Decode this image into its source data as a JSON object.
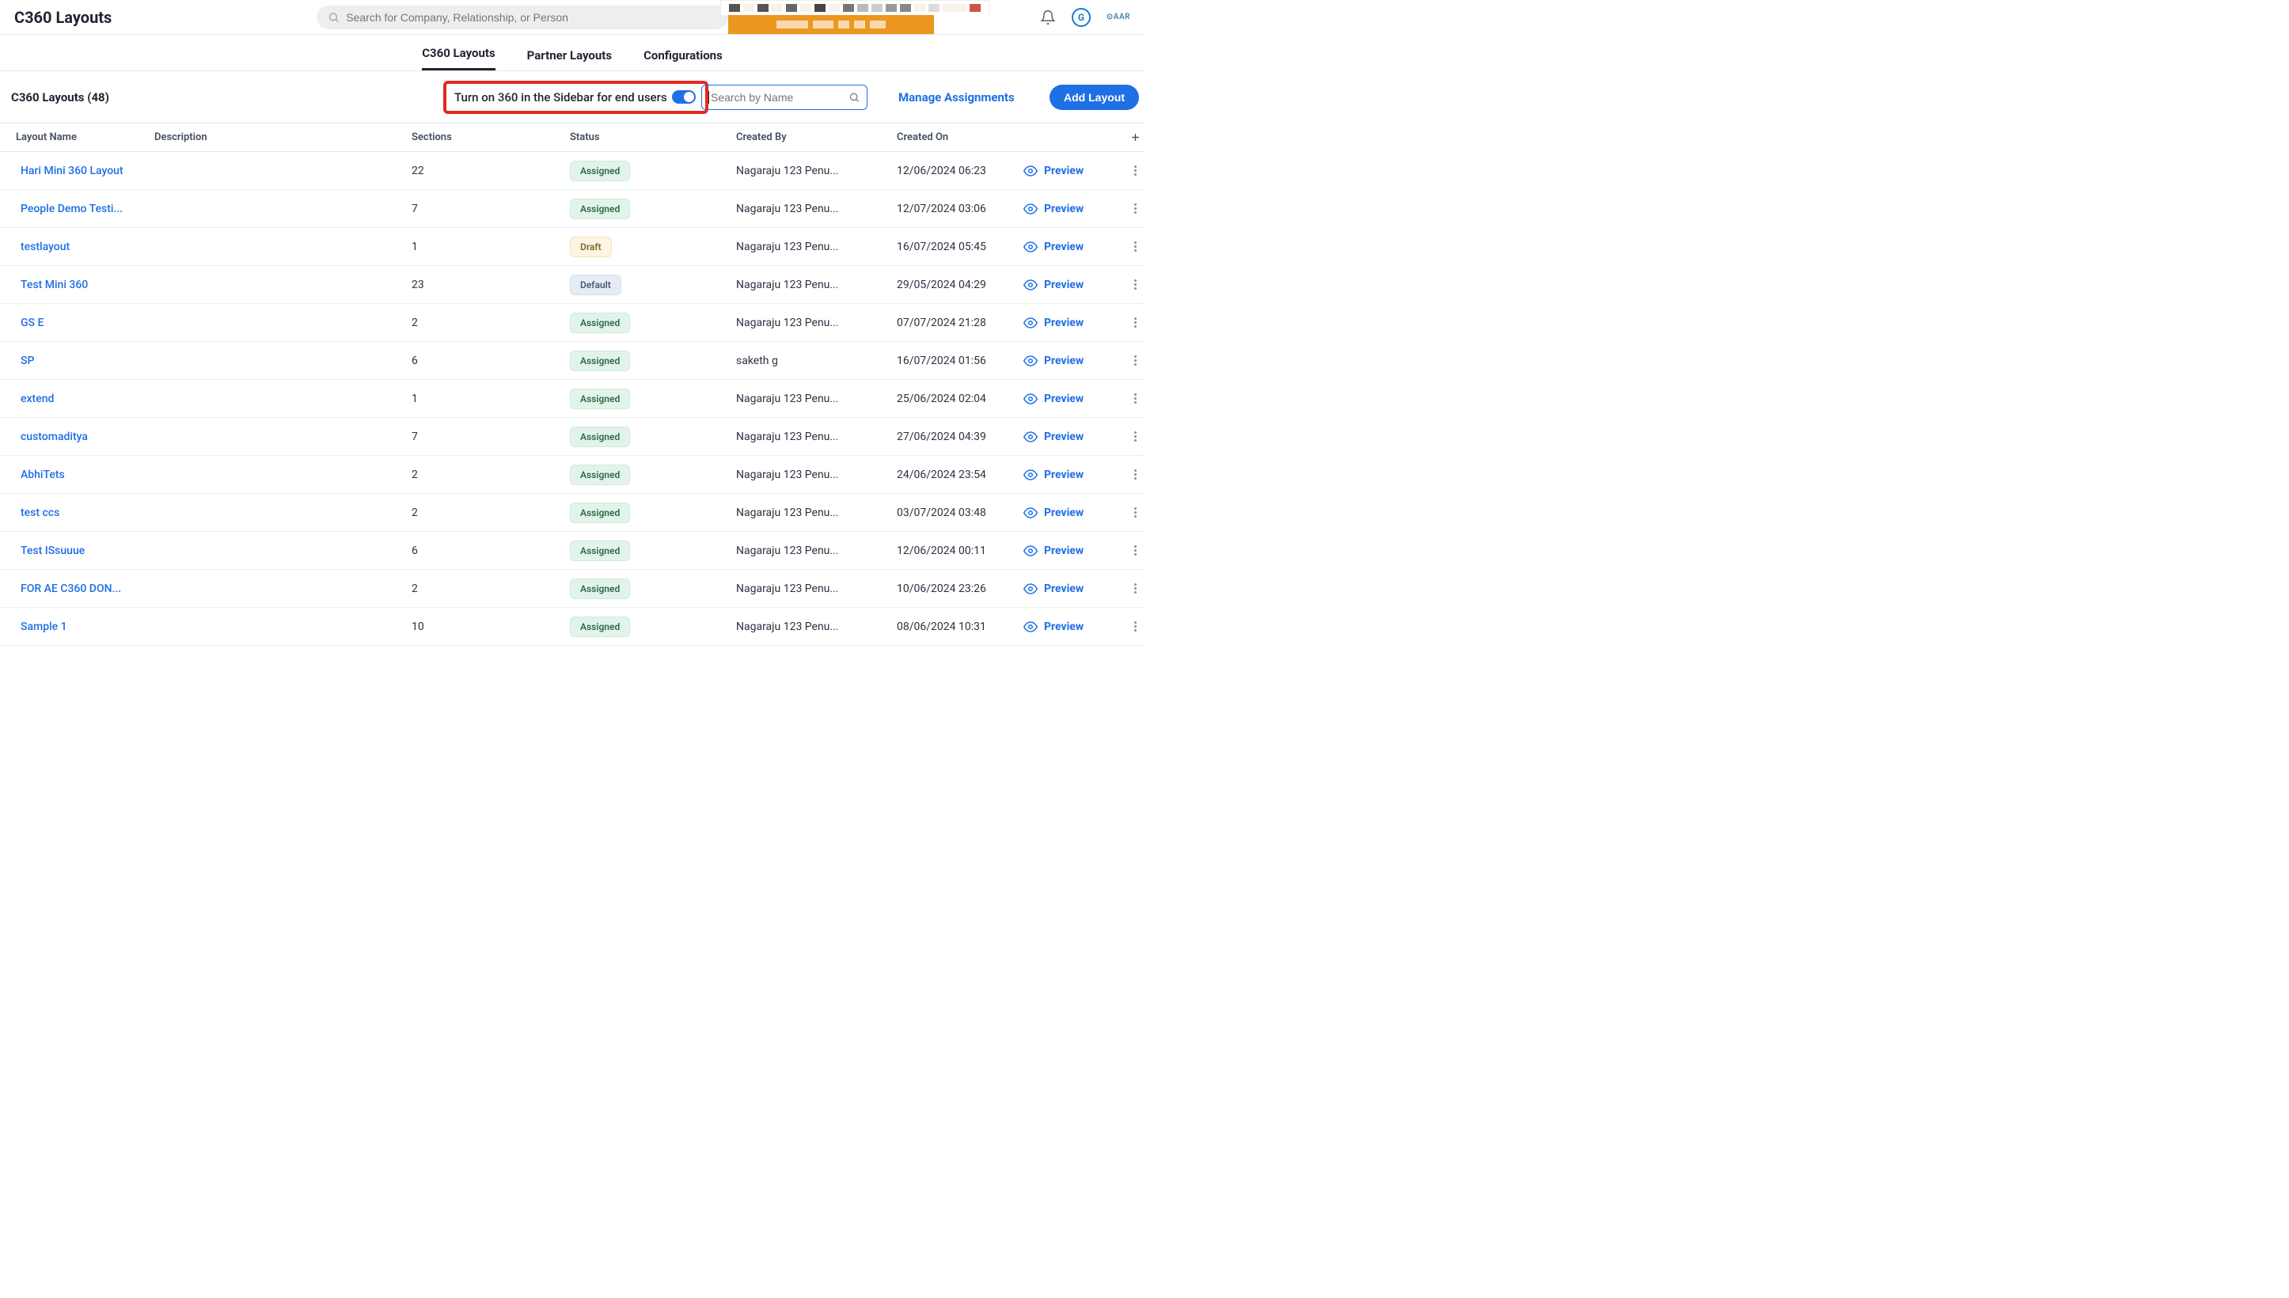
{
  "header": {
    "title": "C360 Layouts",
    "search_placeholder": "Search for Company, Relationship, or Person",
    "g_label": "G",
    "aar_label": "⊙AAR"
  },
  "tabs": [
    {
      "label": "C360 Layouts",
      "active": true
    },
    {
      "label": "Partner Layouts",
      "active": false
    },
    {
      "label": "Configurations",
      "active": false
    }
  ],
  "toolbar": {
    "count_label": "C360 Layouts (48)",
    "toggle_label": "Turn on 360 in the Sidebar for end users",
    "search_placeholder": "Search by Name",
    "manage_label": "Manage Assignments",
    "add_label": "Add Layout"
  },
  "columns": {
    "c0": "Layout Name",
    "c1": "Description",
    "c2": "Sections",
    "c3": "Status",
    "c4": "Created By",
    "c5": "Created On"
  },
  "preview_label": "Preview",
  "rows": [
    {
      "name": "Hari Mini 360 Layout",
      "desc": "",
      "sections": "22",
      "status": "Assigned",
      "status_kind": "assigned",
      "created_by": "Nagaraju 123 Penu...",
      "created_on": "12/06/2024 06:23"
    },
    {
      "name": "People Demo Testi...",
      "desc": "",
      "sections": "7",
      "status": "Assigned",
      "status_kind": "assigned",
      "created_by": "Nagaraju 123 Penu...",
      "created_on": "12/07/2024 03:06"
    },
    {
      "name": "testlayout",
      "desc": "",
      "sections": "1",
      "status": "Draft",
      "status_kind": "draft",
      "created_by": "Nagaraju 123 Penu...",
      "created_on": "16/07/2024 05:45"
    },
    {
      "name": "Test Mini 360",
      "desc": "",
      "sections": "23",
      "status": "Default",
      "status_kind": "default",
      "created_by": "Nagaraju 123 Penu...",
      "created_on": "29/05/2024 04:29"
    },
    {
      "name": "GS E",
      "desc": "",
      "sections": "2",
      "status": "Assigned",
      "status_kind": "assigned",
      "created_by": "Nagaraju 123 Penu...",
      "created_on": "07/07/2024 21:28"
    },
    {
      "name": "SP",
      "desc": "",
      "sections": "6",
      "status": "Assigned",
      "status_kind": "assigned",
      "created_by": "saketh g",
      "created_on": "16/07/2024 01:56"
    },
    {
      "name": "extend",
      "desc": "",
      "sections": "1",
      "status": "Assigned",
      "status_kind": "assigned",
      "created_by": "Nagaraju 123 Penu...",
      "created_on": "25/06/2024 02:04"
    },
    {
      "name": "customaditya",
      "desc": "",
      "sections": "7",
      "status": "Assigned",
      "status_kind": "assigned",
      "created_by": "Nagaraju 123 Penu...",
      "created_on": "27/06/2024 04:39"
    },
    {
      "name": "AbhiTets",
      "desc": "",
      "sections": "2",
      "status": "Assigned",
      "status_kind": "assigned",
      "created_by": "Nagaraju 123 Penu...",
      "created_on": "24/06/2024 23:54"
    },
    {
      "name": "test ccs",
      "desc": "",
      "sections": "2",
      "status": "Assigned",
      "status_kind": "assigned",
      "created_by": "Nagaraju 123 Penu...",
      "created_on": "03/07/2024 03:48"
    },
    {
      "name": "Test ISsuuue",
      "desc": "",
      "sections": "6",
      "status": "Assigned",
      "status_kind": "assigned",
      "created_by": "Nagaraju 123 Penu...",
      "created_on": "12/06/2024 00:11"
    },
    {
      "name": "FOR AE C360 DON...",
      "desc": "",
      "sections": "2",
      "status": "Assigned",
      "status_kind": "assigned",
      "created_by": "Nagaraju 123 Penu...",
      "created_on": "10/06/2024 23:26"
    },
    {
      "name": "Sample 1",
      "desc": "",
      "sections": "10",
      "status": "Assigned",
      "status_kind": "assigned",
      "created_by": "Nagaraju 123 Penu...",
      "created_on": "08/06/2024 10:31"
    }
  ]
}
